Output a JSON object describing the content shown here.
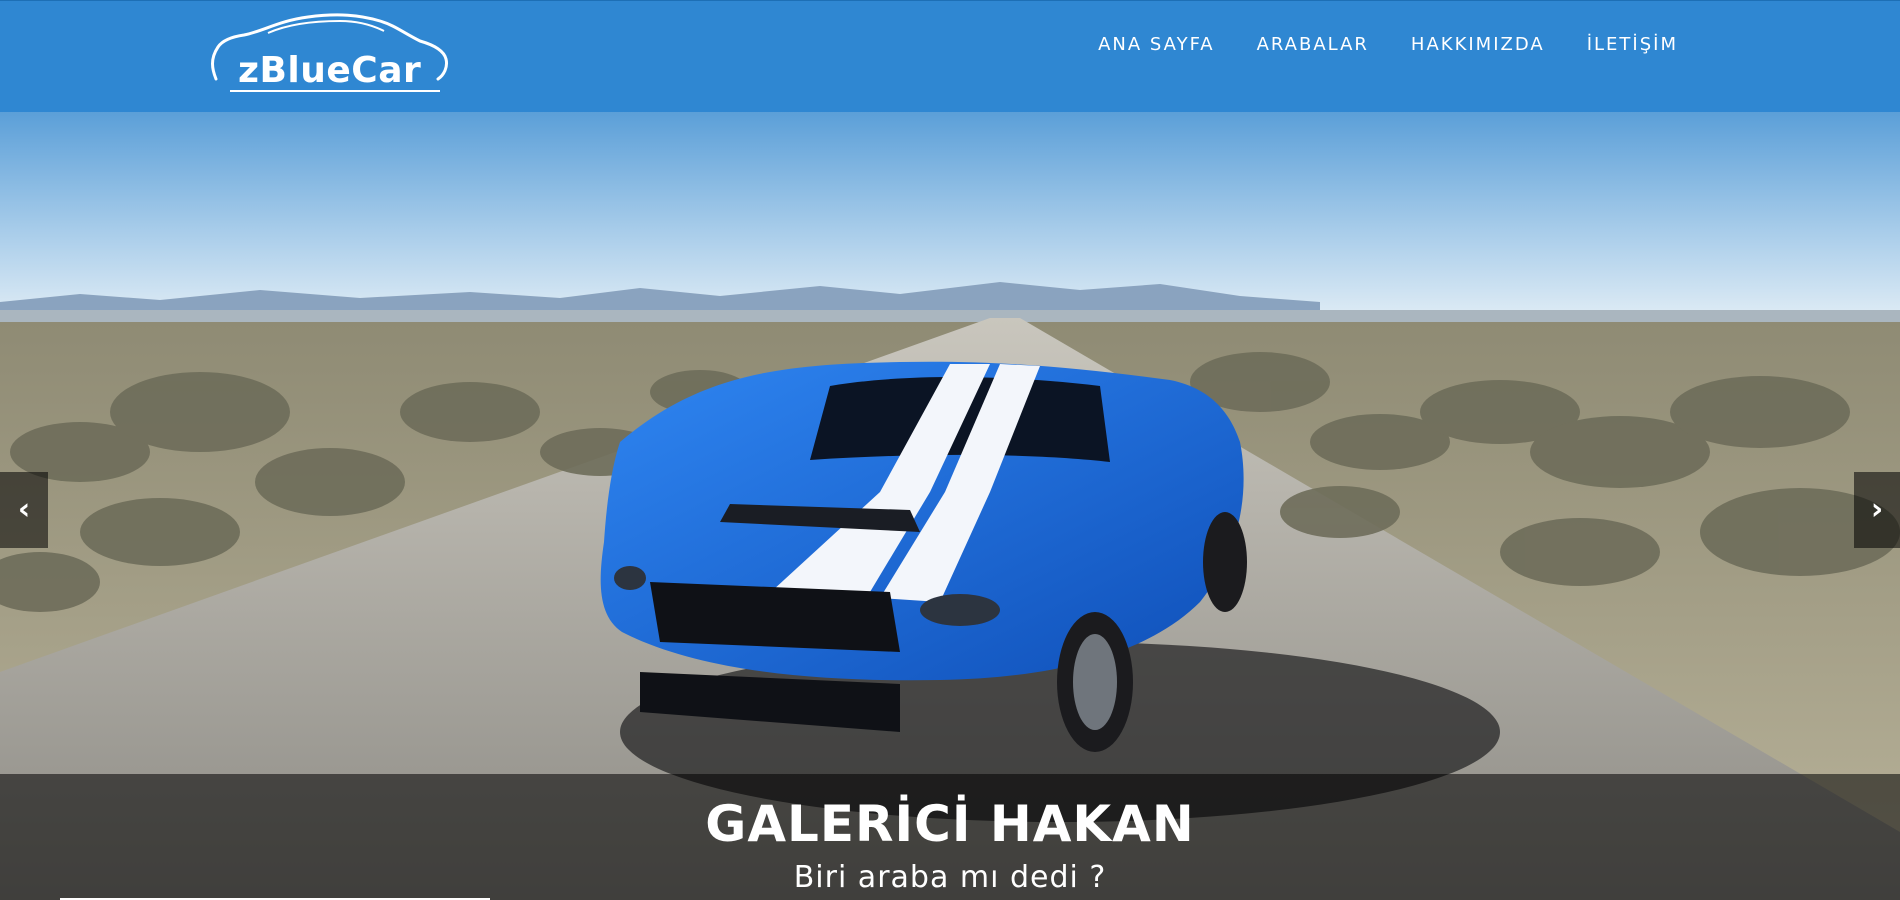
{
  "brand": {
    "name": "zBlueCar"
  },
  "nav": {
    "items": [
      {
        "label": "ANA SAYFA"
      },
      {
        "label": "ARABALAR"
      },
      {
        "label": "HAKKIMIZDA"
      },
      {
        "label": "İLETİŞİM"
      }
    ]
  },
  "hero": {
    "title": "GALERİCİ HAKAN",
    "subtitle": "Biri araba mı dedi ?",
    "prev_icon": "chevron-left-icon",
    "next_icon": "chevron-right-icon"
  },
  "colors": {
    "navbar": "#2f87d2",
    "car": "#1f6fe0",
    "caption_band": "rgba(0,0,0,0.55)",
    "text": "#ffffff"
  }
}
